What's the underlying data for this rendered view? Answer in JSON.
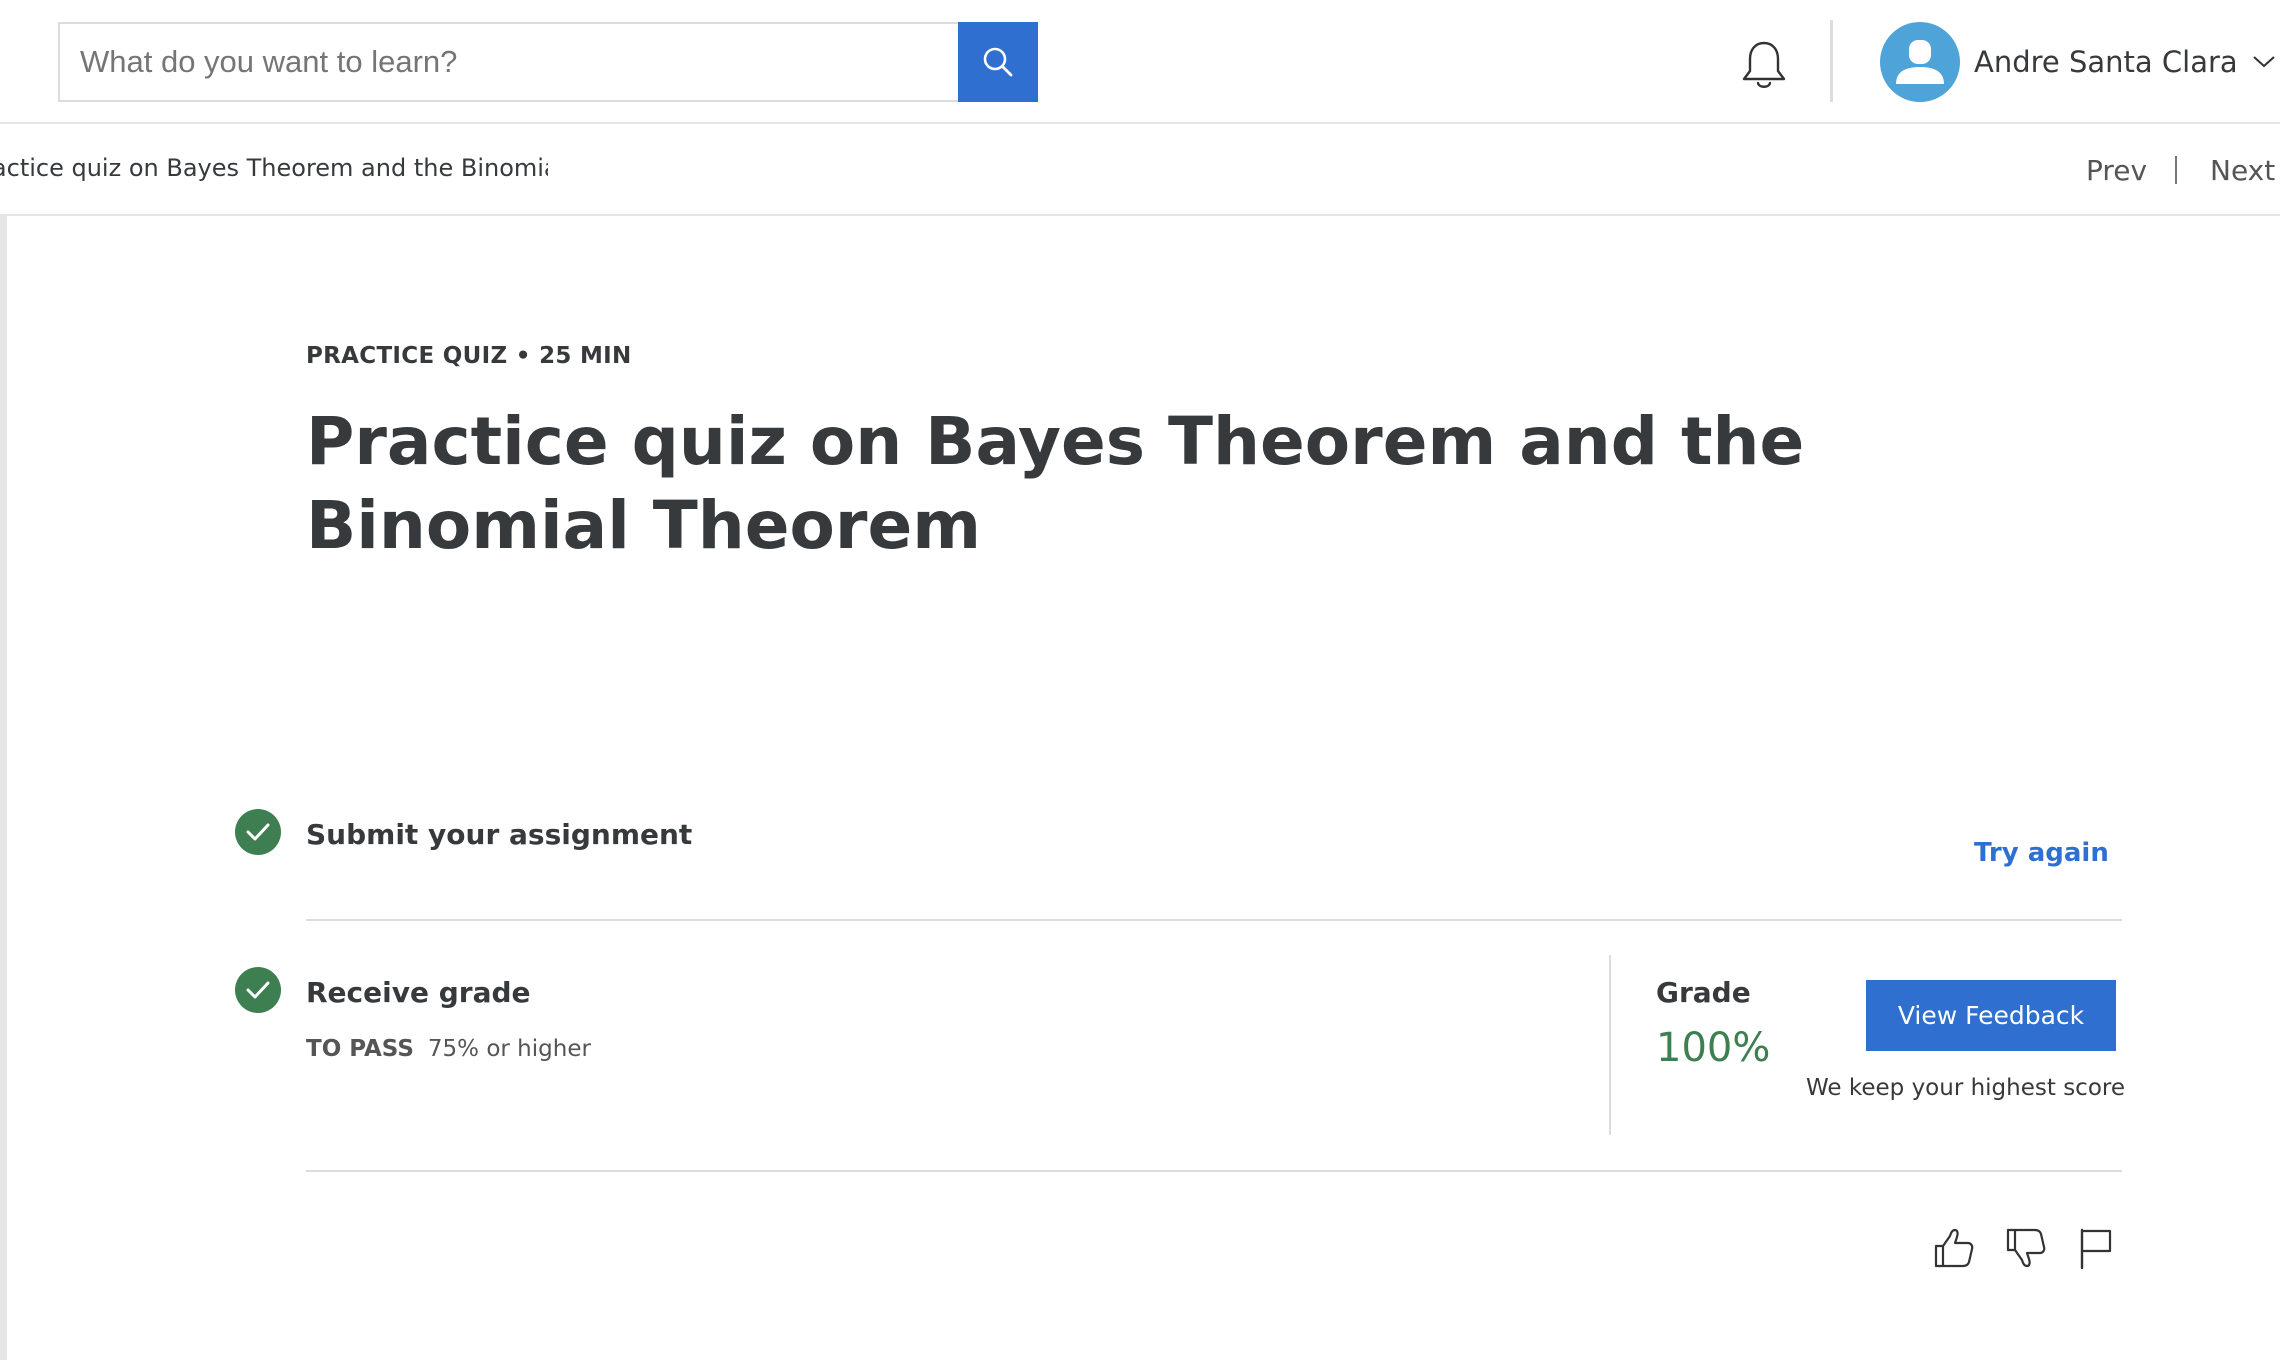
{
  "header": {
    "search": {
      "placeholder": "What do you want to learn?",
      "value": ""
    },
    "user": {
      "name": "Andre Santa Clara"
    }
  },
  "breadcrumb": {
    "title": "Practice quiz on Bayes Theorem and the Binomial Theorem",
    "prev_label": "Prev",
    "next_label": "Next"
  },
  "main": {
    "eyebrow": "PRACTICE QUIZ • 25 MIN",
    "title": "Practice quiz on Bayes Theorem and the Binomial Theorem",
    "steps": [
      {
        "label": "Submit your assignment",
        "status": "complete",
        "action_label": "Try again"
      },
      {
        "label": "Receive grade",
        "status": "complete",
        "pass_label": "TO PASS",
        "pass_value": "75% or higher"
      }
    ],
    "grade": {
      "label": "Grade",
      "value": "100%",
      "button_label": "View Feedback",
      "note": "We keep your highest score"
    }
  },
  "colors": {
    "accent": "#2f6fcf",
    "success": "#3e7f51",
    "avatar": "#4ea3d8",
    "text": "#373a3c"
  },
  "icons": [
    "search-icon",
    "bell-icon",
    "user-icon",
    "chevron-down-icon",
    "check-icon",
    "thumbs-up-icon",
    "thumbs-down-icon",
    "flag-icon"
  ]
}
